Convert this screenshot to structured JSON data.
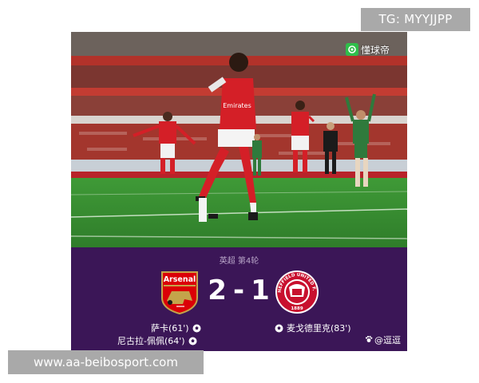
{
  "watermarks": {
    "top": "TG: MYYJJPP",
    "bottom": "www.aa-beibosport.com"
  },
  "photo": {
    "app_badge": "懂球帝",
    "sponsor_text": "Emirates"
  },
  "match": {
    "competition": "英超 第4轮",
    "home_team": {
      "crest_text": "Arsenal",
      "score": "2"
    },
    "away_team": {
      "crest_text": "SHEFFIELD UNITED F.C.",
      "crest_year": "1889",
      "score": "1"
    },
    "separator": "-",
    "home_scorers": [
      "萨卡(61')",
      "尼古拉-佩佩(64')"
    ],
    "away_scorers": [
      "麦戈德里克(83')"
    ],
    "author": "@逗逗"
  },
  "colors": {
    "panel": "#3b1657",
    "arsenal_red": "#db0007",
    "sheffield_red": "#c8102e",
    "pitch": "#3c8a35"
  }
}
